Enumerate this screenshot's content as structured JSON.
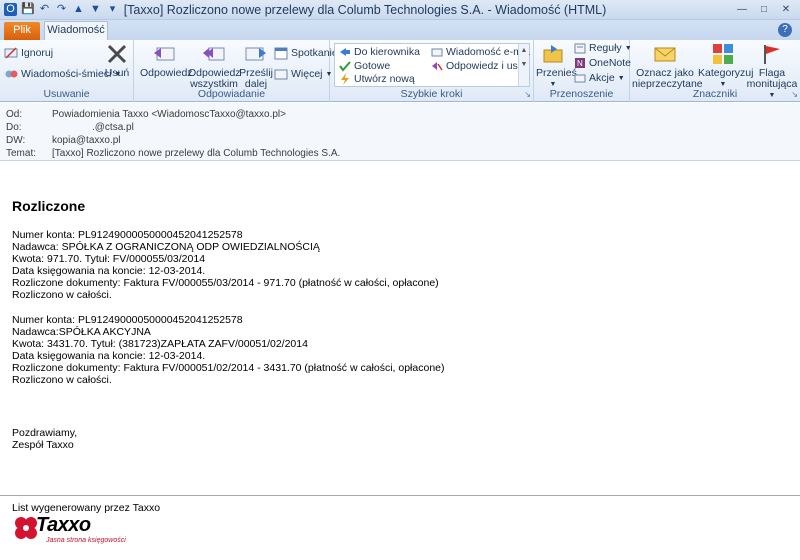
{
  "window": {
    "title": "[Taxxo] Rozliczono nowe przelewy dla Columb Technologies S.A.  -  Wiadomość (HTML)"
  },
  "tabs": {
    "file": "Plik",
    "message": "Wiadomość"
  },
  "ribbon": {
    "delete_group": {
      "label": "Usuwanie",
      "ignore": "Ignoruj",
      "junk": "Wiadomości-śmieci",
      "delete": "Usuń"
    },
    "respond_group": {
      "label": "Odpowiadanie",
      "reply": "Odpowiedz",
      "reply_all": "Odpowiedz wszystkim",
      "forward": "Prześlij dalej",
      "meeting": "Spotkanie",
      "more": "Więcej"
    },
    "quick_steps": {
      "label": "Szybkie kroki",
      "items": [
        "Do kierownika",
        "Wiadomość e-m...",
        "Gotowe",
        "Odpowiedz i us...",
        "Utwórz nową"
      ]
    },
    "move_group": {
      "label": "Przenoszenie",
      "move": "Przenieś",
      "rules": "Reguły",
      "onenote": "OneNote",
      "actions": "Akcje"
    },
    "tags_group": {
      "label": "Znaczniki",
      "mark_unread": "Oznacz jako nieprzeczytane",
      "categorize": "Kategoryzuj",
      "followup": "Flaga monitująca"
    }
  },
  "headers": {
    "from_label": "Od:",
    "from_value": "Powiadomienia Taxxo <WiadomoscTaxxo@taxxo.pl>",
    "to_label": "Do:",
    "to_value": ".@ctsa.pl",
    "cc_label": "DW:",
    "cc_value": "kopia@taxxo.pl",
    "subject_label": "Temat:",
    "subject_value": "[Taxxo] Rozliczono nowe przelewy dla Columb Technologies S.A."
  },
  "body": {
    "heading": "Rozliczone",
    "block1": [
      "Numer konta: PL91249000050000452041252578",
      "Nadawca: SPÓŁKA Z OGRANICZONĄ ODP OWIEDZIALNOŚCIĄ",
      "Kwota: 971.70. Tytuł: FV/000055/03/2014",
      "Data księgowania na koncie: 12-03-2014.",
      "Rozliczone dokumenty: Faktura FV/000055/03/2014 - 971.70 (płatność w całości, opłacone)",
      "Rozliczono w całości."
    ],
    "block2": [
      "Numer konta: PL91249000050000452041252578",
      "Nadawca:SPÓŁKA AKCYJNA",
      "Kwota: 3431.70. Tytuł: (381723)ZAPŁATA ZAFV/00051/02/2014",
      "Data księgowania na koncie: 12-03-2014.",
      "Rozliczone dokumenty: Faktura FV/000051/02/2014 - 3431.70 (płatność w całości, opłacone)",
      "Rozliczono w całości."
    ],
    "greeting": "Pozdrawiamy,",
    "signature": "Zespół Taxxo",
    "footer": "List wygenerowany przez Taxxo",
    "logo_text": "Taxxo",
    "logo_tagline": "Jasna strona księgowości"
  }
}
